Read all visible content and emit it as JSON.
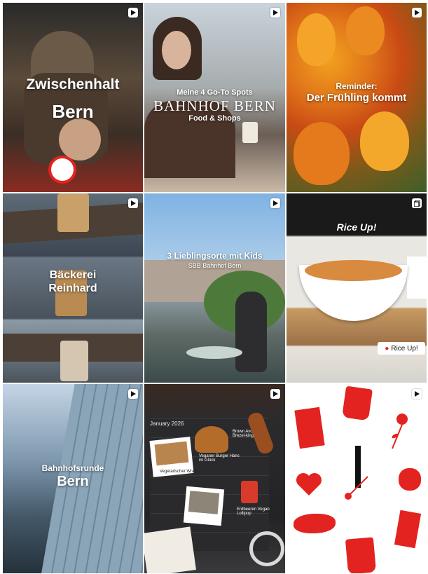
{
  "tiles": [
    {
      "type": "reel",
      "title_1": "Zwischenhalt",
      "title_2": "Bern"
    },
    {
      "type": "reel",
      "kicker": "Meine 4 Go-To Spots",
      "title": "BAHNHOF BERN",
      "subtitle": "Food & Shops"
    },
    {
      "type": "reel",
      "kicker": "Reminder:",
      "title": "Der Frühling kommt"
    },
    {
      "type": "reel",
      "title_1": "Bäckerei",
      "title_2": "Reinhard"
    },
    {
      "type": "reel",
      "title": "3 Lieblingsorte mit Kids",
      "subtitle": "SBB Bahnhof Bern"
    },
    {
      "type": "carousel",
      "sign": "Rice Up!",
      "pin_label": "Rice Up!"
    },
    {
      "type": "reel",
      "title_1": "Bahnhofsrunde",
      "title_2": "Bern"
    },
    {
      "type": "reel",
      "calendar_month": "January 2026",
      "label_burger": "Veganer Burger Hans im Glück",
      "label_avocado": "Brown Avocado Brezel-king",
      "label_wrap": "Vegetarischer Wrap",
      "label_lollipop": "Erdbeeren Vegan Lollipop"
    },
    {
      "type": "reel"
    }
  ],
  "colors": {
    "accent_red": "#e3231f",
    "white": "#ffffff"
  }
}
